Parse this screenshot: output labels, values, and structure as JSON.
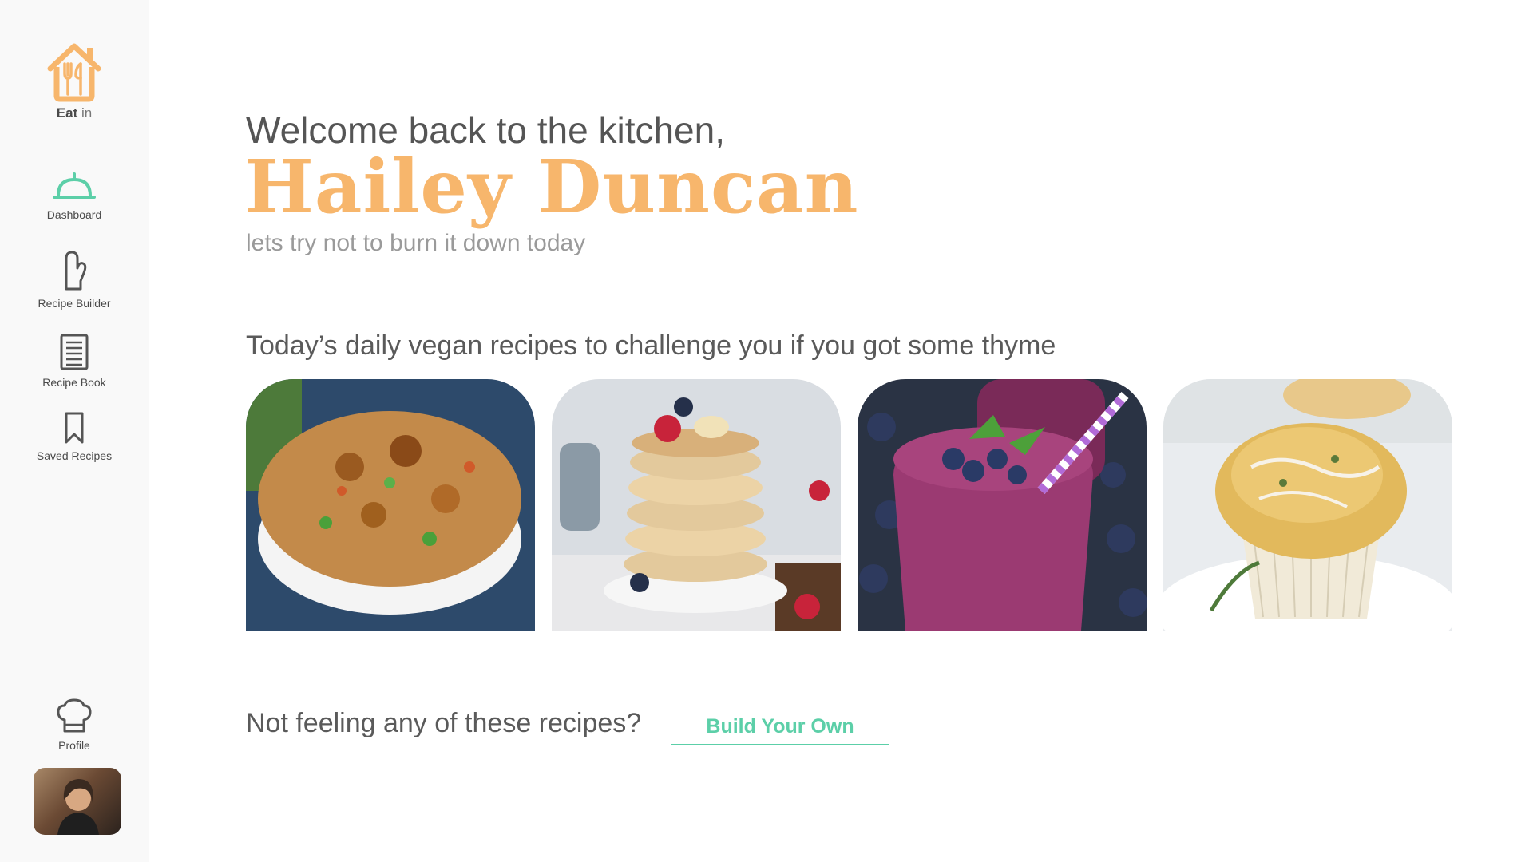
{
  "brand": {
    "name_bold": "Eat",
    "name_light": "in"
  },
  "nav": {
    "items": [
      {
        "label": "Dashboard",
        "icon": "cloche-icon"
      },
      {
        "label": "Recipe Builder",
        "icon": "oven-mitt-icon"
      },
      {
        "label": "Recipe Book",
        "icon": "book-icon"
      },
      {
        "label": "Saved Recipes",
        "icon": "bookmark-icon"
      }
    ],
    "profile": {
      "label": "Profile",
      "icon": "chef-hat-icon"
    }
  },
  "header": {
    "welcome": "Welcome back to the kitchen,",
    "user_name": "Hailey Duncan",
    "tagline": "lets try not to burn it down today"
  },
  "recipes": {
    "section_title": "Today’s daily vegan recipes to challenge you if you got some thyme",
    "cards": [
      {
        "image": "fried-rice-tofu-photo"
      },
      {
        "image": "pancake-stack-photo"
      },
      {
        "image": "berry-smoothie-photo"
      },
      {
        "image": "muffin-photo"
      }
    ]
  },
  "cta": {
    "text": "Not feeling any of these recipes?",
    "button_label": "Build Your Own"
  },
  "colors": {
    "accent_green": "#5ccfa8",
    "accent_orange": "#f7b66c",
    "sidebar_bg": "#f9f9f9",
    "text_dark": "#555555"
  }
}
